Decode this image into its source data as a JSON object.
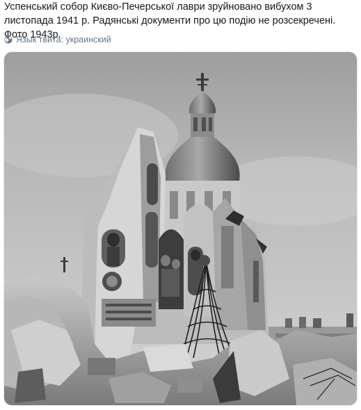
{
  "tweet": {
    "text": "Успенський собор Києво-Печерської лаври зруйновано вибухом 3 листопада 1941 р. Радянські документи про цю подію не розсекречені. Фото 1943р.",
    "language_label": "Язык твита: украинский",
    "language_icon": "globe-icon"
  },
  "photo": {
    "kind": "black-and-white archival photograph",
    "subject": "ruins of cathedral with onion dome"
  }
}
